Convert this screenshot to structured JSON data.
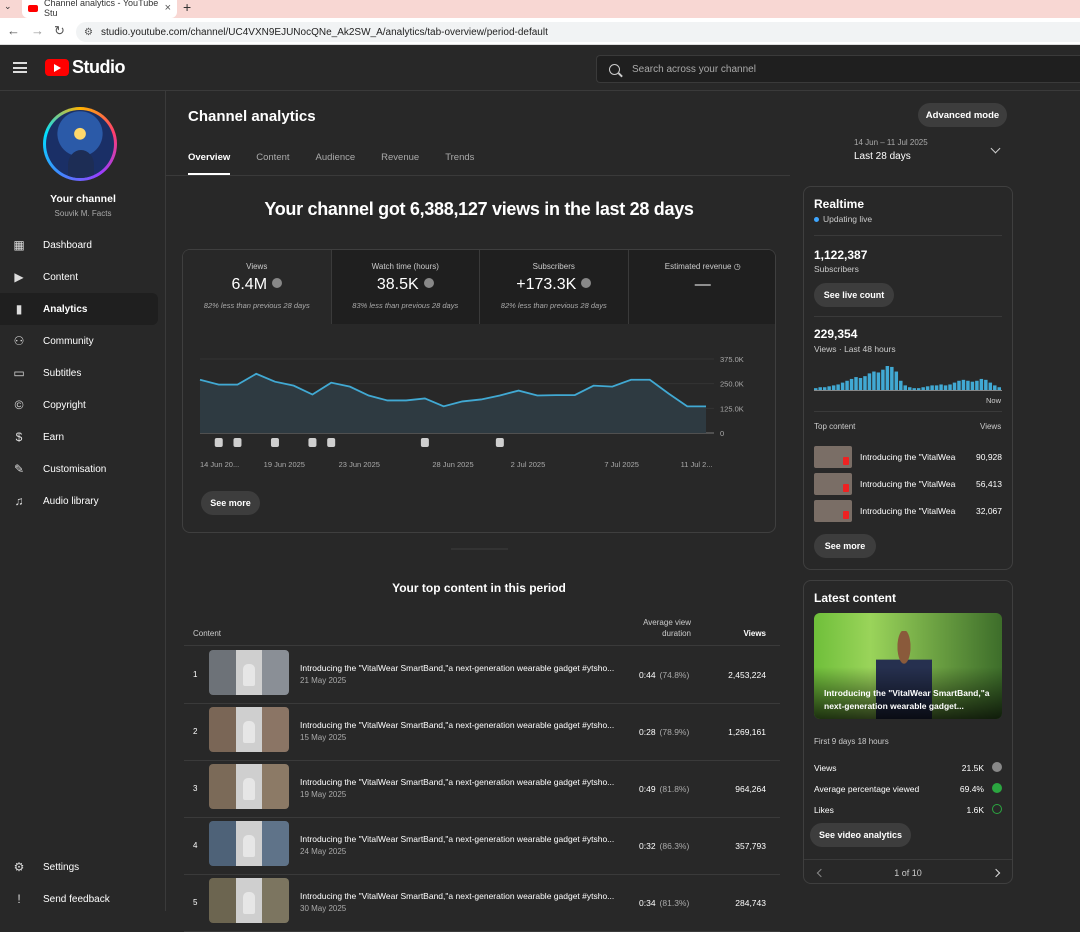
{
  "browser": {
    "tab_title": "Channel analytics - YouTube Stu",
    "url": "studio.youtube.com/channel/UC4VXN9EJUNocQNe_Ak2SW_A/analytics/tab-overview/period-default"
  },
  "header": {
    "logo_text": "Studio",
    "search_placeholder": "Search across your channel"
  },
  "sidebar": {
    "channel_title": "Your channel",
    "channel_name": "Souvik M. Facts",
    "items": [
      {
        "label": "Dashboard",
        "icon": "dashboard-icon"
      },
      {
        "label": "Content",
        "icon": "content-icon"
      },
      {
        "label": "Analytics",
        "icon": "analytics-icon",
        "active": true
      },
      {
        "label": "Community",
        "icon": "community-icon"
      },
      {
        "label": "Subtitles",
        "icon": "subtitles-icon"
      },
      {
        "label": "Copyright",
        "icon": "copyright-icon"
      },
      {
        "label": "Earn",
        "icon": "earn-icon"
      },
      {
        "label": "Customisation",
        "icon": "customisation-icon"
      },
      {
        "label": "Audio library",
        "icon": "audio-library-icon"
      }
    ],
    "bottom": [
      {
        "label": "Settings",
        "icon": "settings-icon"
      },
      {
        "label": "Send feedback",
        "icon": "feedback-icon"
      }
    ]
  },
  "main": {
    "title": "Channel analytics",
    "tabs": [
      "Overview",
      "Content",
      "Audience",
      "Revenue",
      "Trends"
    ],
    "advanced_mode": "Advanced mode",
    "date_range_sub": "14 Jun – 11 Jul 2025",
    "date_range": "Last 28 days",
    "headline": "Your channel got 6,388,127 views in the last 28 days",
    "metrics": [
      {
        "label": "Views",
        "value": "6.4M",
        "change": "82% less than previous 28 days"
      },
      {
        "label": "Watch time (hours)",
        "value": "38.5K",
        "change": "83% less than previous 28 days"
      },
      {
        "label": "Subscribers",
        "value": "+173.3K",
        "change": "82% less than previous 28 days"
      },
      {
        "label": "Estimated revenue",
        "value": "—",
        "change": ""
      }
    ],
    "see_more": "See more",
    "top_content_title": "Your top content in this period",
    "table_headers": {
      "content": "Content",
      "avg_line1": "Average view",
      "avg_line2": "duration",
      "views": "Views"
    },
    "rows": [
      {
        "rank": "1",
        "title": "Introducing the \"VitalWear SmartBand,\"a next-generation wearable gadget #ytsho...",
        "date": "21 May 2025",
        "duration": "0:44",
        "pct": "(74.8%)",
        "views": "2,453,224"
      },
      {
        "rank": "2",
        "title": "Introducing the \"VitalWear SmartBand,\"a next-generation wearable gadget #ytsho...",
        "date": "15 May 2025",
        "duration": "0:28",
        "pct": "(78.9%)",
        "views": "1,269,161"
      },
      {
        "rank": "3",
        "title": "Introducing the \"VitalWear SmartBand,\"a next-generation wearable gadget #ytsho...",
        "date": "19 May 2025",
        "duration": "0:49",
        "pct": "(81.8%)",
        "views": "964,264"
      },
      {
        "rank": "4",
        "title": "Introducing the \"VitalWear SmartBand,\"a next-generation wearable gadget #ytsho...",
        "date": "24 May 2025",
        "duration": "0:32",
        "pct": "(86.3%)",
        "views": "357,793"
      },
      {
        "rank": "5",
        "title": "Introducing the \"VitalWear SmartBand,\"a next-generation wearable gadget #ytsho...",
        "date": "30 May 2025",
        "duration": "0:34",
        "pct": "(81.3%)",
        "views": "284,743"
      }
    ]
  },
  "chart_data": {
    "type": "area",
    "series": [
      {
        "values": [
          270000,
          245000,
          245000,
          300000,
          260000,
          240000,
          195000,
          255000,
          235000,
          190000,
          165000,
          165000,
          175000,
          135000,
          160000,
          170000,
          190000,
          215000,
          190000,
          192000,
          192000,
          240000,
          235000,
          270000,
          270000,
          200000,
          135000,
          135000
        ]
      }
    ],
    "x_tick_labels": [
      "14 Jun 20...",
      "19 Jun 2025",
      "23 Jun 2025",
      "28 Jun 2025",
      "2 Jul 2025",
      "7 Jul 2025",
      "11 Jul 2..."
    ],
    "y_tick_labels": [
      "375.0K",
      "250.0K",
      "125.0K",
      "0"
    ],
    "ylim": [
      0,
      375000
    ],
    "marker_days": [
      1,
      2,
      4,
      6,
      7,
      12,
      16
    ]
  },
  "realtime": {
    "title": "Realtime",
    "status": "Updating live",
    "subscribers_value": "1,122,387",
    "subscribers_label": "Subscribers",
    "live_count_button": "See live count",
    "views_value": "229,354",
    "views_label": "Views · Last 48 hours",
    "now_label": "Now",
    "bars": [
      2,
      3,
      3,
      4,
      5,
      6,
      8,
      10,
      12,
      14,
      13,
      15,
      18,
      20,
      19,
      22,
      26,
      25,
      20,
      10,
      5,
      3,
      2,
      2,
      3,
      4,
      5,
      5,
      6,
      5,
      6,
      8,
      10,
      11,
      10,
      9,
      10,
      12,
      11,
      8,
      5,
      3
    ],
    "top_content_label": "Top content",
    "views_col_label": "Views",
    "top_items": [
      {
        "title": "Introducing the \"VitalWear",
        "views": "90,928"
      },
      {
        "title": "Introducing the \"VitalWear",
        "views": "56,413"
      },
      {
        "title": "Introducing the \"VitalWear",
        "views": "32,067"
      }
    ],
    "see_more": "See more"
  },
  "latest": {
    "title": "Latest content",
    "video_title": "Introducing the \"VitalWear SmartBand,\"a next-generation wearable gadget...",
    "period": "First 9 days 18 hours",
    "stats": [
      {
        "label": "Views",
        "value": "21.5K",
        "icon_color": "#888888"
      },
      {
        "label": "Average percentage viewed",
        "value": "69.4%",
        "icon_color": "#2ba640"
      },
      {
        "label": "Likes",
        "value": "1.6K",
        "icon_color": "#2ba640"
      }
    ],
    "analytics_button": "See video analytics",
    "pager": "1 of 10"
  },
  "colors": {
    "accent": "#3ea6ff",
    "chart_line": "#41a9d3",
    "red": "#ff0000"
  }
}
